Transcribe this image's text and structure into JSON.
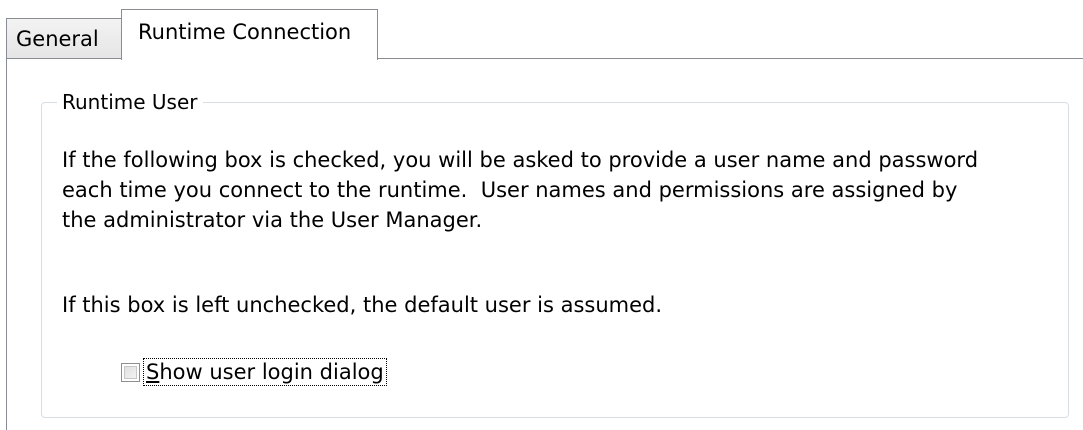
{
  "tabs": [
    {
      "label": "General",
      "active": false
    },
    {
      "label": "Runtime Connection",
      "active": true
    }
  ],
  "group": {
    "title": "Runtime User",
    "paragraph_lines": [
      "If the following box is checked, you will be asked to provide a user name and password",
      "each time you connect to the runtime.  User names and permissions are assigned by",
      "the administrator via the User Manager."
    ],
    "note": "If this box is left unchecked, the default user is assumed.",
    "checkbox": {
      "access_key": "S",
      "label_rest": "how user login dialog",
      "checked": false
    }
  },
  "colors": {
    "tab_border": "#898c95",
    "group_border": "#d5dfe5",
    "background": "#ffffff"
  }
}
